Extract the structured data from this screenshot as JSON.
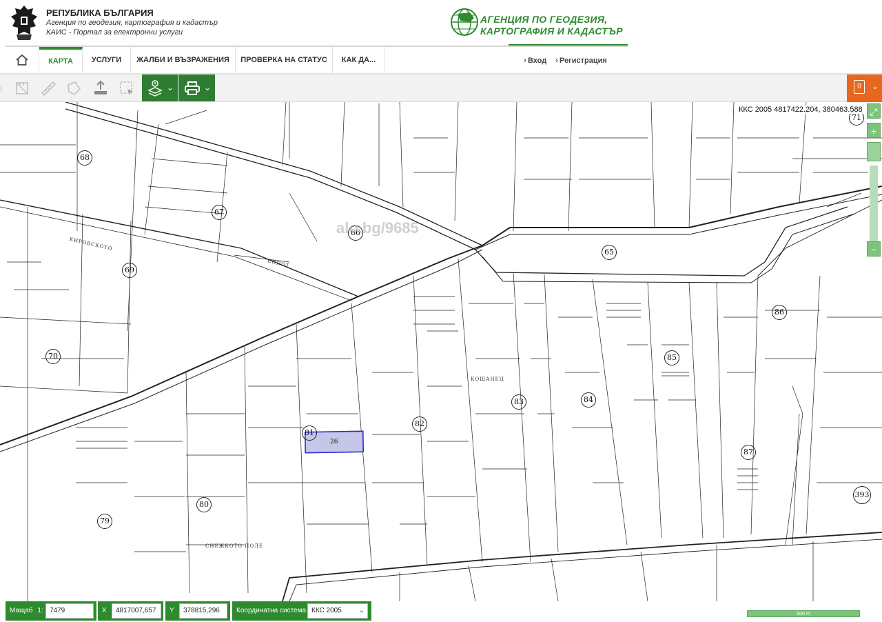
{
  "header": {
    "org_title": "РЕПУБЛИКА БЪЛГАРИЯ",
    "org_sub1": "Агенция по геодезия, картография и кадастър",
    "org_sub2": "КАИС - Портал за електронни услуги",
    "agency_line1": "АГЕНЦИЯ ПО ГЕОДЕЗИЯ,",
    "agency_line2": "КАРТОГРАФИЯ И КАДАСТЪР"
  },
  "nav": {
    "items": [
      {
        "label": "КАРТА"
      },
      {
        "label": "УСЛУГИ"
      },
      {
        "label": "ЖАЛБИ И ВЪЗРАЖЕНИЯ"
      },
      {
        "label": "ПРОВЕРКА НА СТАТУС"
      },
      {
        "label": "КАК ДА..."
      }
    ],
    "login": "Вход",
    "register": "Регистрация"
  },
  "toolbar": {
    "icons": [
      "measure-area-icon",
      "ruler-icon",
      "polygon-icon",
      "upload-icon",
      "select-area-icon",
      "layers-icon",
      "print-icon"
    ],
    "orange_badge": "0"
  },
  "map": {
    "coord_readout": "ККС 2005 4817422.204, 380463.588",
    "watermark": "alo.bg/9685",
    "localities": [
      "КИРОВСКОТО",
      "СОПОТ",
      "КОЩАНЕЦ",
      "СНЕЖКОТО ПОЛЕ"
    ],
    "circled_labels": [
      "68",
      "67",
      "66",
      "65",
      "71",
      "69",
      "70",
      "86",
      "85",
      "84",
      "83",
      "82",
      "81",
      "80",
      "79",
      "87",
      "393"
    ],
    "selected_parcel": "26",
    "colors": {
      "selected_fill": "#c6c6e8",
      "selected_stroke": "#2a2ad0",
      "accent": "#2e8a2e"
    }
  },
  "zoom": {
    "plus": "+",
    "minus": "−",
    "expand": "⤢"
  },
  "statusbar": {
    "scale_label": "Мащаб",
    "scale_prefix": "1:",
    "scale_value": "7479",
    "x_label": "X",
    "x_value": "4817007,657",
    "y_label": "Y",
    "y_value": "378815,296",
    "cs_label": "Координатна система",
    "cs_value": "ККС 2005",
    "scalebar_text": "500 m"
  }
}
